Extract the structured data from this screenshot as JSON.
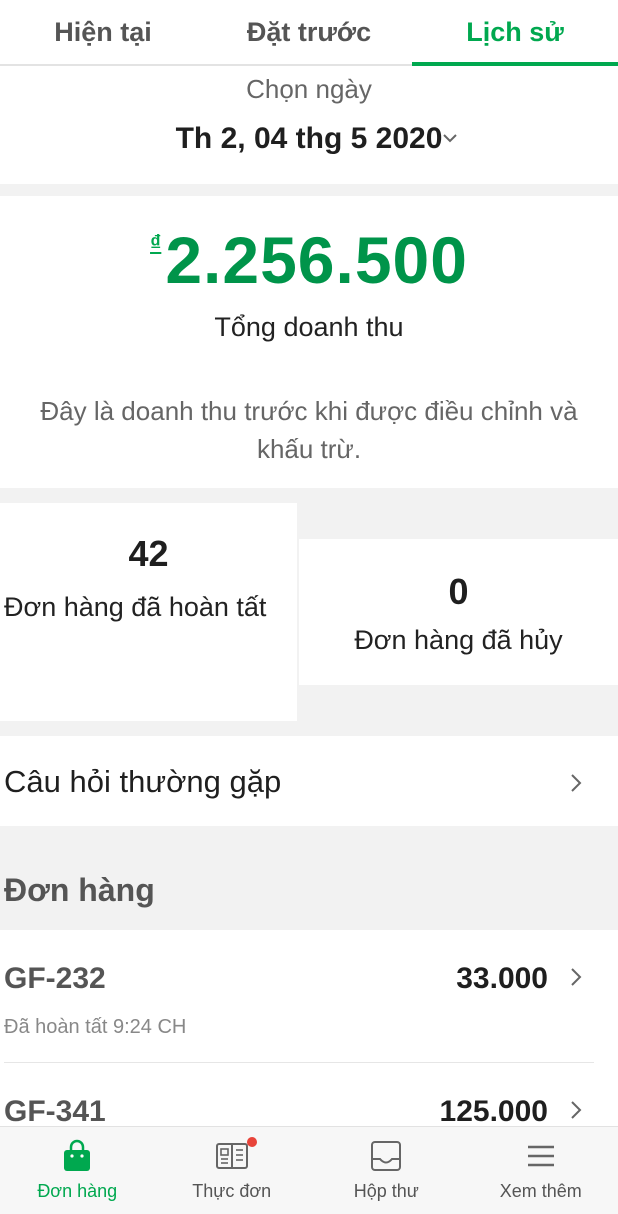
{
  "tabs": [
    {
      "label": "Hiện tại"
    },
    {
      "label": "Đặt trước"
    },
    {
      "label": "Lịch sử"
    }
  ],
  "date": {
    "label": "Chọn ngày",
    "value": "Th 2, 04 thg 5 2020"
  },
  "revenue": {
    "currency": "₫",
    "amount": "2.256.500",
    "label": "Tổng doanh thu",
    "note": "Đây là doanh thu trước khi được điều chỉnh và khấu trừ."
  },
  "stats": {
    "completed": {
      "count": "42",
      "label": "Đơn hàng đã hoàn tất"
    },
    "cancelled": {
      "count": "0",
      "label": "Đơn hàng đã hủy"
    }
  },
  "faq": {
    "label": "Câu hỏi thường gặp"
  },
  "orders": {
    "title": "Đơn hàng",
    "items": [
      {
        "id": "GF-232",
        "amount": "33.000",
        "status": "Đã hoàn tất 9:24 CH"
      },
      {
        "id": "GF-341",
        "amount": "125.000",
        "status": ""
      }
    ]
  },
  "bottom_nav": [
    {
      "label": "Đơn hàng",
      "icon": "shopping-bag-icon"
    },
    {
      "label": "Thực đơn",
      "icon": "menu-book-icon"
    },
    {
      "label": "Hộp thư",
      "icon": "inbox-icon"
    },
    {
      "label": "Xem thêm",
      "icon": "hamburger-icon"
    }
  ],
  "colors": {
    "accent": "#00a84f",
    "notification": "#e8443a"
  }
}
